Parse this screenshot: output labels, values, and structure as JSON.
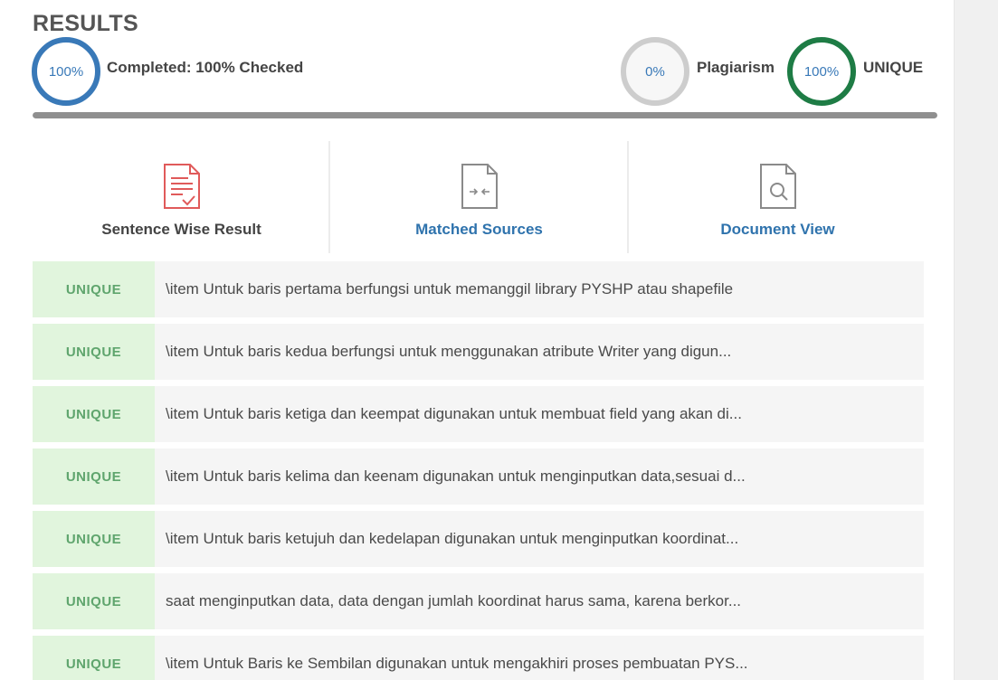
{
  "results": {
    "title": "RESULTS",
    "completed_ring": "100%",
    "completed_label": "Completed: 100% Checked",
    "plagiarism_ring": "0%",
    "plagiarism_label": "Plagiarism",
    "unique_ring": "100%",
    "unique_label": "UNIQUE",
    "progress_percent": 100
  },
  "tabs": [
    {
      "label": "Sentence Wise Result",
      "icon": "document-check-icon"
    },
    {
      "label": "Matched Sources",
      "icon": "document-compare-icon"
    },
    {
      "label": "Document View",
      "icon": "document-search-icon"
    }
  ],
  "colors": {
    "completed_ring": "#3979b8",
    "plagiarism_ring": "#cdcdcd",
    "unique_ring": "#1e7c45",
    "badge_bg": "#e1f5dd",
    "badge_text": "#5fa56d",
    "link_blue": "#2f73ad"
  },
  "rows": [
    {
      "status": "UNIQUE",
      "text": "\\item Untuk baris pertama berfungsi untuk memanggil library PYSHP atau shapefile"
    },
    {
      "status": "UNIQUE",
      "text": "\\item Untuk baris kedua berfungsi untuk menggunakan atribute Writer yang digun..."
    },
    {
      "status": "UNIQUE",
      "text": "\\item Untuk baris ketiga dan keempat digunakan untuk membuat field yang akan di..."
    },
    {
      "status": "UNIQUE",
      "text": "\\item Untuk baris kelima dan keenam digunakan untuk menginputkan data,sesuai d..."
    },
    {
      "status": "UNIQUE",
      "text": "\\item Untuk baris ketujuh dan kedelapan digunakan untuk menginputkan koordinat..."
    },
    {
      "status": "UNIQUE",
      "text": "saat menginputkan data, data dengan jumlah koordinat harus sama, karena berkor..."
    },
    {
      "status": "UNIQUE",
      "text": "\\item Untuk Baris ke Sembilan digunakan untuk mengakhiri proses pembuatan PYS..."
    }
  ]
}
